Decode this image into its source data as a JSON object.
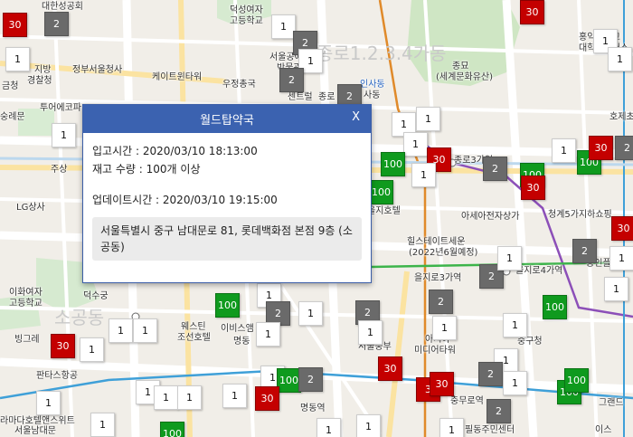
{
  "popup": {
    "title": "월드탑약국",
    "close_label": "X",
    "received": "입고시간 : 2020/03/10 18:13:00",
    "stock": "재고 수량 : 100개 이상",
    "updated": "업데이트시간 : 2020/03/10 19:15:00",
    "address": "서울특별시 중구 남대문로 81, 롯데백화점 본점 9층 (소공동)"
  },
  "map_labels": [
    {
      "text": "대한성공회",
      "kind": "normal"
    },
    {
      "text": "덕성여자",
      "kind": "normal"
    },
    {
      "text": "고등학교",
      "kind": "normal"
    },
    {
      "text": "서울공예",
      "kind": "normal"
    },
    {
      "text": "박물관",
      "kind": "normal"
    },
    {
      "text": "인사동",
      "kind": "blue"
    },
    {
      "text": "종로1.2.3.4가동",
      "kind": "big"
    },
    {
      "text": "종묘",
      "kind": "normal"
    },
    {
      "text": "(세계문화유산)",
      "kind": "normal"
    },
    {
      "text": "홍익대학교",
      "kind": "normal"
    },
    {
      "text": "대학로캠퍼스",
      "kind": "normal"
    },
    {
      "text": "지방",
      "kind": "normal"
    },
    {
      "text": "경찰청",
      "kind": "normal"
    },
    {
      "text": "정부서울청사",
      "kind": "normal"
    },
    {
      "text": "케이트윈타워",
      "kind": "normal"
    },
    {
      "text": "우정총국",
      "kind": "normal"
    },
    {
      "text": "센트럴",
      "kind": "normal"
    },
    {
      "text": "종로",
      "kind": "normal"
    },
    {
      "text": "숭례문",
      "kind": "normal"
    },
    {
      "text": "투어에코파",
      "kind": "normal"
    },
    {
      "text": "종로3가역",
      "kind": "normal"
    },
    {
      "text": "호제초",
      "kind": "normal"
    },
    {
      "text": "주상",
      "kind": "normal"
    },
    {
      "text": "LG상사",
      "kind": "normal"
    },
    {
      "text": "을지호텔",
      "kind": "normal"
    },
    {
      "text": "아세아전자상가",
      "kind": "normal"
    },
    {
      "text": "청계5가지하쇼핑",
      "kind": "normal"
    },
    {
      "text": "힐스테이트세운",
      "kind": "normal"
    },
    {
      "text": "(2022년6월예정)",
      "kind": "normal"
    },
    {
      "text": "을지로3가역",
      "kind": "normal"
    },
    {
      "text": "을지로4가역",
      "kind": "normal"
    },
    {
      "text": "공인플라자",
      "kind": "normal"
    },
    {
      "text": "이화여자",
      "kind": "normal"
    },
    {
      "text": "고등학교",
      "kind": "normal"
    },
    {
      "text": "덕수궁",
      "kind": "normal"
    },
    {
      "text": "소공동",
      "kind": "big"
    },
    {
      "text": "웨스틴",
      "kind": "normal"
    },
    {
      "text": "조선호텔",
      "kind": "normal"
    },
    {
      "text": "이비스앰",
      "kind": "normal"
    },
    {
      "text": "명동",
      "kind": "normal"
    },
    {
      "text": "서울중부",
      "kind": "normal"
    },
    {
      "text": "아시아",
      "kind": "normal"
    },
    {
      "text": "미디어타워",
      "kind": "normal"
    },
    {
      "text": "중구청",
      "kind": "normal"
    },
    {
      "text": "빙그레",
      "kind": "normal"
    },
    {
      "text": "판타스항공",
      "kind": "normal"
    },
    {
      "text": "명동역",
      "kind": "normal"
    },
    {
      "text": "충무로역",
      "kind": "normal"
    },
    {
      "text": "필동주민센터",
      "kind": "normal"
    },
    {
      "text": "라마다호텔앤스위트",
      "kind": "normal"
    },
    {
      "text": "서울남대문",
      "kind": "normal"
    },
    {
      "text": "그랜드",
      "kind": "normal"
    },
    {
      "text": "이스",
      "kind": "normal"
    },
    {
      "text": "금청",
      "kind": "normal"
    },
    {
      "text": "사동",
      "kind": "normal"
    }
  ],
  "markers": [
    {
      "label": "30",
      "type": "red"
    },
    {
      "label": "2",
      "type": "gray"
    },
    {
      "label": "30",
      "type": "red"
    },
    {
      "label": "1",
      "type": "white"
    },
    {
      "label": "2",
      "type": "gray"
    },
    {
      "label": "1",
      "type": "white"
    },
    {
      "label": "1",
      "type": "white"
    },
    {
      "label": "1",
      "type": "white"
    },
    {
      "label": "1",
      "type": "white"
    },
    {
      "label": "2",
      "type": "gray"
    },
    {
      "label": "2",
      "type": "gray"
    },
    {
      "label": "1",
      "type": "white"
    },
    {
      "label": "1",
      "type": "white"
    },
    {
      "label": "1",
      "type": "white"
    },
    {
      "label": "1",
      "type": "white"
    },
    {
      "label": "100",
      "type": "green"
    },
    {
      "label": "30",
      "type": "red"
    },
    {
      "label": "1",
      "type": "white"
    },
    {
      "label": "2",
      "type": "gray"
    },
    {
      "label": "100",
      "type": "green"
    },
    {
      "label": "100",
      "type": "green"
    },
    {
      "label": "30",
      "type": "red"
    },
    {
      "label": "100",
      "type": "green"
    },
    {
      "label": "30",
      "type": "red"
    },
    {
      "label": "1",
      "type": "white"
    },
    {
      "label": "2",
      "type": "gray"
    },
    {
      "label": "30",
      "type": "red"
    },
    {
      "label": "1",
      "type": "white"
    },
    {
      "label": "1",
      "type": "white"
    },
    {
      "label": "2",
      "type": "gray"
    },
    {
      "label": "2",
      "type": "gray"
    },
    {
      "label": "1",
      "type": "white"
    },
    {
      "label": "100",
      "type": "green"
    },
    {
      "label": "1",
      "type": "white"
    },
    {
      "label": "100",
      "type": "green"
    },
    {
      "label": "1",
      "type": "white"
    },
    {
      "label": "2",
      "type": "gray"
    },
    {
      "label": "1",
      "type": "white"
    },
    {
      "label": "1",
      "type": "white"
    },
    {
      "label": "2",
      "type": "gray"
    },
    {
      "label": "1",
      "type": "white"
    },
    {
      "label": "2",
      "type": "gray"
    },
    {
      "label": "1",
      "type": "white"
    },
    {
      "label": "1",
      "type": "white"
    },
    {
      "label": "1",
      "type": "white"
    },
    {
      "label": "30",
      "type": "red"
    },
    {
      "label": "1",
      "type": "white"
    },
    {
      "label": "1",
      "type": "white"
    },
    {
      "label": "1",
      "type": "white"
    },
    {
      "label": "1",
      "type": "white"
    },
    {
      "label": "1",
      "type": "white"
    },
    {
      "label": "1",
      "type": "white"
    },
    {
      "label": "1",
      "type": "white"
    },
    {
      "label": "100",
      "type": "green"
    },
    {
      "label": "2",
      "type": "gray"
    },
    {
      "label": "30",
      "type": "red"
    },
    {
      "label": "30",
      "type": "red"
    },
    {
      "label": "3",
      "type": "red"
    },
    {
      "label": "30",
      "type": "red"
    },
    {
      "label": "1",
      "type": "white"
    },
    {
      "label": "2",
      "type": "gray"
    },
    {
      "label": "100",
      "type": "green"
    },
    {
      "label": "100",
      "type": "green"
    },
    {
      "label": "1",
      "type": "white"
    },
    {
      "label": "2",
      "type": "gray"
    },
    {
      "label": "1",
      "type": "white"
    },
    {
      "label": "1",
      "type": "white"
    },
    {
      "label": "1",
      "type": "white"
    },
    {
      "label": "100",
      "type": "green"
    },
    {
      "label": "1",
      "type": "white"
    }
  ]
}
